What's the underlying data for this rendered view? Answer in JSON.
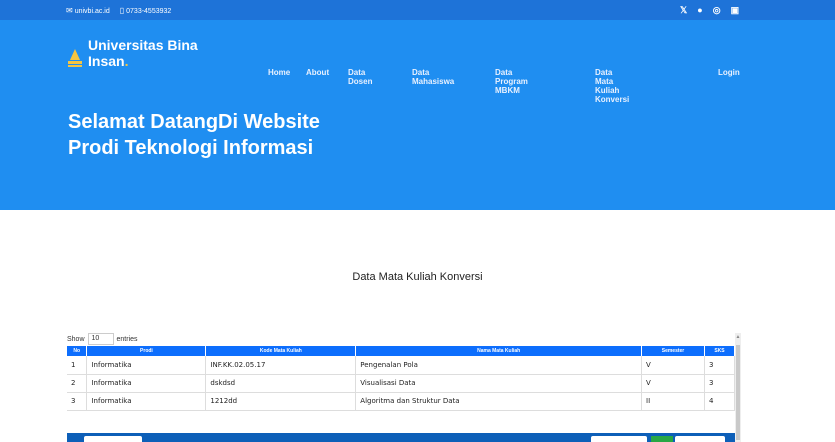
{
  "topbar": {
    "email": "univbi.ac.id",
    "phone": "0733-4553932",
    "social": [
      "twitter-icon",
      "facebook-icon",
      "instagram-icon",
      "linkedin-icon"
    ]
  },
  "brand": {
    "name_line1": "Universitas Bina",
    "name_line2": "Insan",
    "dot": ".",
    "accent_color": "#f5c542"
  },
  "nav": {
    "items": [
      "Home",
      "About",
      "Data Dosen",
      "Data Mahasiswa",
      "Data Program MBKM",
      "Data Mata Kuliah Konversi",
      "Login"
    ]
  },
  "hero": {
    "headline_line1": "Selamat DatangDi Website",
    "headline_line2": "Prodi Teknologi Informasi",
    "bg_color": "#1f8ef1"
  },
  "section": {
    "title": "Data Mata Kuliah Konversi"
  },
  "table_controls": {
    "show_label": "Show",
    "entries_value": "10",
    "entries_label": "entries"
  },
  "table": {
    "headers": [
      "No",
      "Prodi",
      "Kode Mata Kuliah",
      "Nama Mata Kuliah",
      "Semester",
      "SKS"
    ],
    "rows": [
      [
        "1",
        "Informatika",
        "INF.KK.02.05.17",
        "Pengenalan Pola",
        "V",
        "3"
      ],
      [
        "2",
        "Informatika",
        "dskdsd",
        "Visualisasi Data",
        "V",
        "3"
      ],
      [
        "3",
        "Informatika",
        "1212dd",
        "Algoritma dan Struktur Data",
        "II",
        "4"
      ]
    ]
  }
}
